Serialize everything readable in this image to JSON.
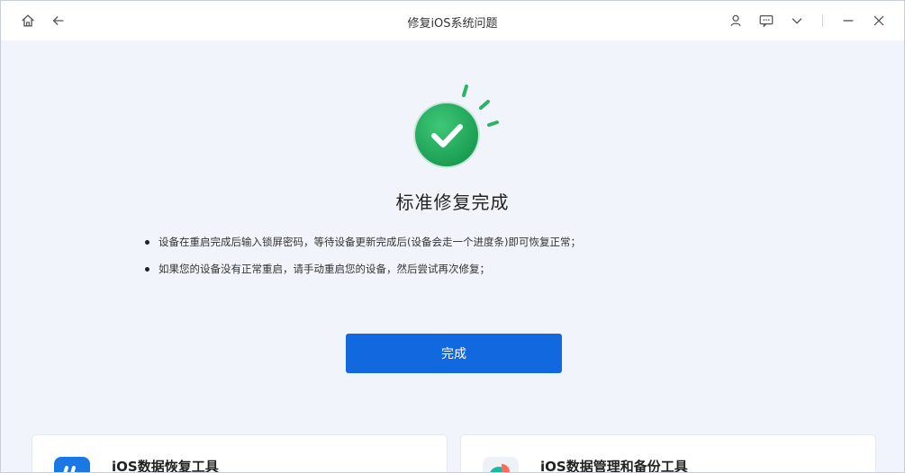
{
  "window": {
    "title": "修复iOS系统问题"
  },
  "titlebar": {
    "left_icons": [
      "home-icon",
      "back-arrow-icon"
    ],
    "right_icons": [
      "user-icon",
      "feedback-icon",
      "chevron-down-icon",
      "minimize-icon",
      "close-icon"
    ]
  },
  "main": {
    "status_icon": "checkmark-icon",
    "title": "标准修复完成",
    "instructions": [
      "设备在重启完成后输入锁屏密码，等待设备更新完成后(设备会走一个进度条)即可恢复正常；",
      "如果您的设备没有正常重启，请手动重启您的设备，然后尝试再次修复；"
    ],
    "done_button_label": "完成"
  },
  "cards": [
    {
      "title": "iOS数据恢复工具",
      "icon": "data-recovery-app-icon"
    },
    {
      "title": "iOS数据管理和备份工具",
      "icon": "data-backup-app-icon"
    }
  ],
  "colors": {
    "accent": "#1168df",
    "success": "#1ea85a",
    "background": "#f1f5fb"
  }
}
